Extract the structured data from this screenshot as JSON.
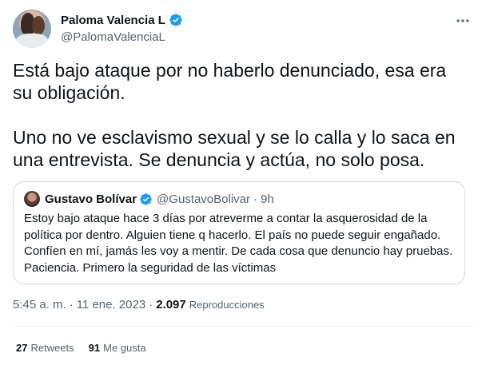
{
  "tweet": {
    "author": {
      "display_name": "Paloma Valencia L",
      "handle": "@PalomaValenciaL",
      "verified": true
    },
    "more_icon": "more-horizontal-icon",
    "text": "Está bajo ataque por no haberlo denunciado, esa era\nsu obligación.\n\nUno no ve esclavismo sexual y se lo calla y lo saca en\nuna entrevista. Se denuncia y actúa, no solo posa.",
    "quoted": {
      "display_name": "Gustavo Bolívar",
      "handle": "@GustavoBolivar",
      "separator": "·",
      "time": "9h",
      "verified": true,
      "text": "Estoy bajo ataque hace 3 días por atreverme a contar la asquerosidad de la\npolítica por dentro. Alguien tiene q hacerlo. El país no puede seguir engañado.\nConfíen en mí, jamás les voy a mentir. De cada cosa que denuncio hay pruebas.\nPaciencia. Primero la seguridad de las víctimas"
    },
    "meta": {
      "time": "5:45 a. m.",
      "separator": "·",
      "date": "11 ene. 2023",
      "views_count": "2.097",
      "views_label": "Reproducciones"
    },
    "stats": {
      "retweets_count": "27",
      "retweets_label": "Retweets",
      "likes_count": "91",
      "likes_label": "Me gusta"
    },
    "colors": {
      "verified_blue": "#1d9bf0",
      "secondary_text": "#536471",
      "primary_text": "#0f1419",
      "border": "#cfd9de"
    }
  }
}
